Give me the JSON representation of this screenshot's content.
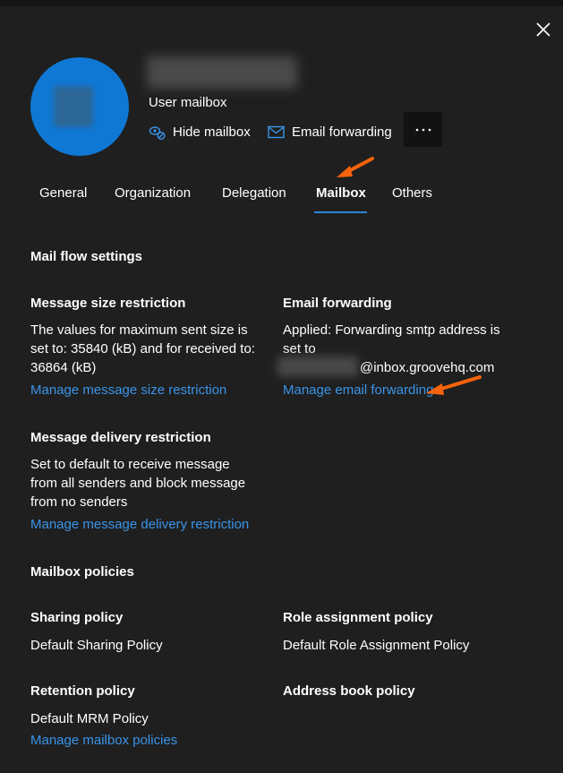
{
  "window": {
    "close_icon": "close-icon"
  },
  "profile": {
    "type_label": "User mailbox",
    "actions": [
      {
        "label": "Hide mailbox",
        "icon": "hide-mailbox-icon"
      },
      {
        "label": "Email forwarding",
        "icon": "mail-icon"
      }
    ],
    "more_icon": "more-dots-icon",
    "avatar_color": "#0f78d4"
  },
  "tabs": [
    {
      "label": "General",
      "active": false
    },
    {
      "label": "Organization",
      "active": false
    },
    {
      "label": "Delegation",
      "active": false
    },
    {
      "label": "Mailbox",
      "active": true
    },
    {
      "label": "Others",
      "active": false
    }
  ],
  "mail_flow": {
    "title": "Mail flow settings",
    "message_size": {
      "heading": "Message size restriction",
      "lines": [
        "The values for maximum sent size is",
        "set to: 35840 (kB) and for received to:",
        "36864 (kB)"
      ],
      "link": "Manage message size restriction"
    },
    "email_forwarding": {
      "heading": "Email forwarding",
      "lines": [
        "Applied: Forwarding smtp address is",
        "set to"
      ],
      "address_suffix": "@inbox.groovehq.com",
      "link": "Manage email forwarding"
    },
    "delivery": {
      "heading": "Message delivery restriction",
      "lines": [
        "Set to default to receive message",
        "from all senders and block message",
        "from no senders"
      ],
      "link": "Manage message delivery restriction"
    }
  },
  "policies": {
    "title": "Mailbox policies",
    "sharing": {
      "heading": "Sharing policy",
      "value": "Default Sharing Policy"
    },
    "role": {
      "heading": "Role assignment policy",
      "value": "Default Role Assignment Policy"
    },
    "retention": {
      "heading": "Retention policy",
      "value": "Default MRM Policy"
    },
    "address_book": {
      "heading": "Address book policy"
    },
    "link": "Manage mailbox policies"
  },
  "colors": {
    "background": "#1f1f1f",
    "link": "#3a94e8",
    "accent": "#2f86d7",
    "annotation_arrow": "#f7630c"
  }
}
